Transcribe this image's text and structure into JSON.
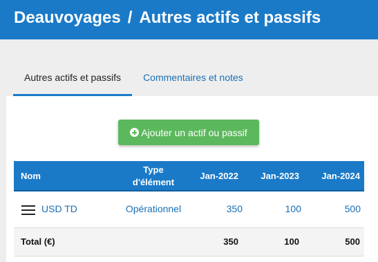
{
  "header": {
    "company": "Deauvoyages",
    "separator": "/",
    "page": "Autres actifs et passifs"
  },
  "tabs": [
    {
      "label": "Autres actifs et passifs",
      "active": true
    },
    {
      "label": "Commentaires et notes",
      "active": false
    }
  ],
  "add_button": {
    "label": "Ajouter un actif ou passif",
    "icon": "plus-circle-icon"
  },
  "table": {
    "columns": {
      "name": "Nom",
      "type_line1": "Type",
      "type_line2": "d'élément",
      "years": [
        "Jan-2022",
        "Jan-2023",
        "Jan-2024"
      ]
    },
    "rows": [
      {
        "name": "USD TD",
        "type": "Opérationnel",
        "values": [
          "350",
          "100",
          "500"
        ]
      }
    ],
    "total": {
      "label": "Total (€)",
      "values": [
        "350",
        "100",
        "500"
      ]
    }
  },
  "colors": {
    "header_blue": "#1a7ac8",
    "button_green": "#5cb85c",
    "link_blue": "#1a6fb5"
  }
}
